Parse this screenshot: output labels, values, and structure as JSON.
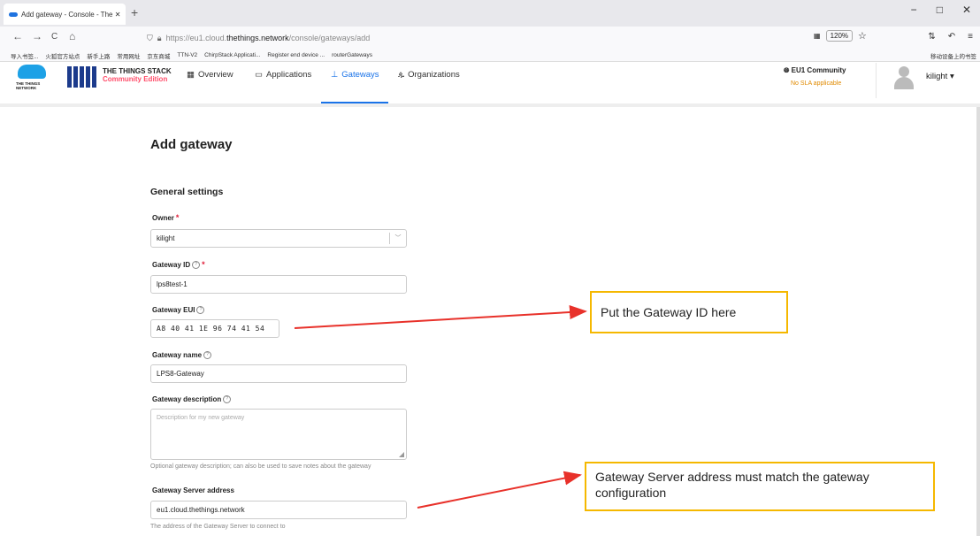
{
  "browser": {
    "tab_title": "Add gateway - Console - The ✕",
    "tab_close": "✕",
    "new_tab": "+",
    "win_min": "−",
    "win_max": "□",
    "win_close": "✕",
    "nav_back": "←",
    "nav_forward": "→",
    "nav_reload": "C",
    "nav_home": "⌂",
    "url_prefix": "https://eu1.cloud.",
    "url_domain": "thethings.network",
    "url_path": "/console/gateways/add",
    "zoom": "120%",
    "star": "☆",
    "bookmarks": [
      "导入书签...",
      "火狐官方站点",
      "新手上路",
      "常用网址",
      "京东商城",
      "TTN-V2",
      "ChirpStack Applicati...",
      "Register end device ...",
      "routerGateways"
    ],
    "bookmarks_right": "移动设备上的书签"
  },
  "header": {
    "ttn_logo_text": "THE THINGS NETWORK",
    "stack_title": "THE THINGS STACK",
    "stack_edition": "Community Edition",
    "nav": [
      {
        "label": "Overview",
        "icon": "▦"
      },
      {
        "label": "Applications",
        "icon": "▭"
      },
      {
        "label": "Gateways",
        "icon": "⊥"
      },
      {
        "label": "Organizations",
        "icon": "ዹ"
      }
    ],
    "cluster": "EU1 Community",
    "sla": "No SLA applicable",
    "user": "kilight",
    "user_caret": "▾"
  },
  "form": {
    "page_title": "Add gateway",
    "section_title": "General settings",
    "owner_label": "Owner",
    "owner_value": "kilight",
    "gateway_id_label": "Gateway ID",
    "gateway_id_value": "lps8test-1",
    "gateway_eui_label": "Gateway EUI",
    "gateway_eui_value": "A8 40 41 1E 96 74 41 54",
    "gateway_name_label": "Gateway name",
    "gateway_name_value": "LPS8-Gateway",
    "gateway_desc_label": "Gateway description",
    "gateway_desc_placeholder": "Description for my new gateway",
    "gateway_desc_hint": "Optional gateway description; can also be used to save notes about the gateway",
    "gs_address_label": "Gateway Server address",
    "gs_address_value": "eu1.cloud.thethings.network",
    "gs_address_hint": "The address of the Gateway Server to connect to",
    "required_mark": "*",
    "help_mark": "?"
  },
  "annotations": {
    "callout1": "Put the Gateway ID here",
    "callout2": "Gateway Server address must match the gateway configuration",
    "arrow_color": "#e8312a",
    "border_color": "#f5b800"
  }
}
